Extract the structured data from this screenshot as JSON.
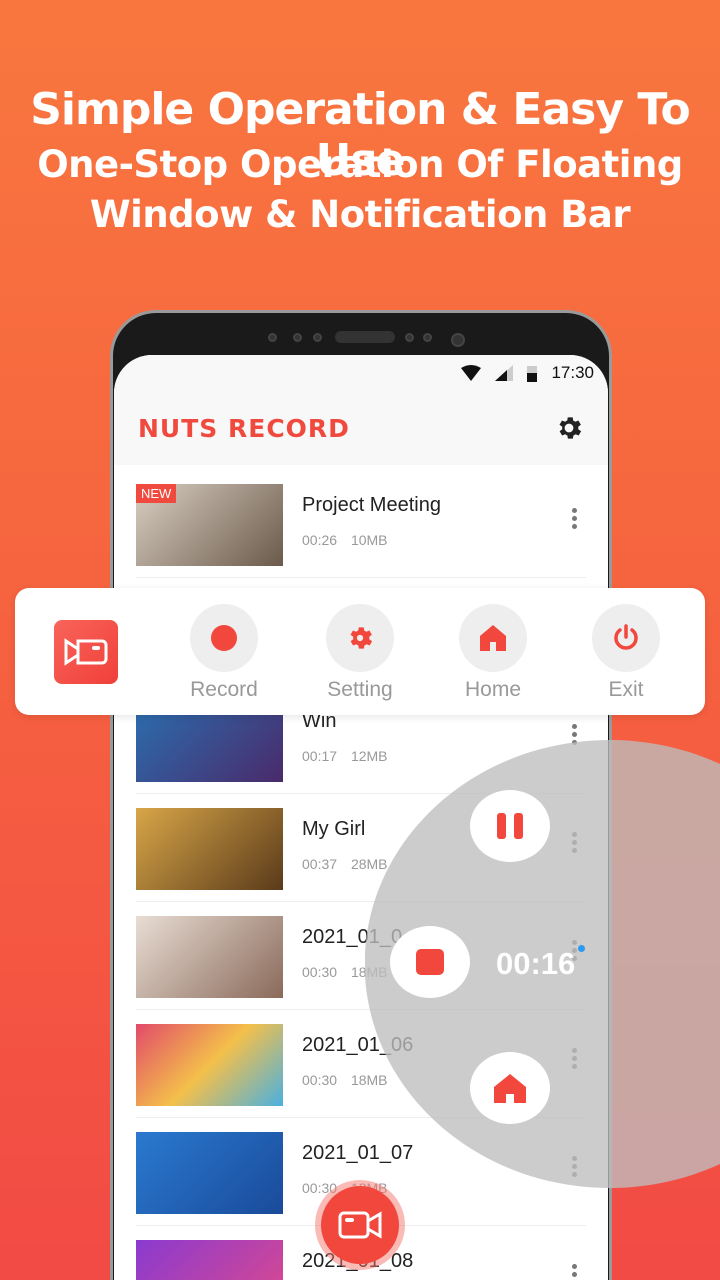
{
  "headline": "Simple Operation & Easy To Use",
  "subheadline_line1": "One-Stop Operation Of Floating",
  "subheadline_line2": "Window & Notification Bar",
  "status_bar": {
    "time": "17:30"
  },
  "app": {
    "logo_text": "NUTS RECORD",
    "accent": "#f04a3f"
  },
  "videos": [
    {
      "title": "Project Meeting",
      "duration": "00:26",
      "size": "10MB",
      "badge": "NEW"
    },
    {
      "title": "",
      "duration": "",
      "size": ""
    },
    {
      "title": "Win",
      "duration": "00:17",
      "size": "12MB"
    },
    {
      "title": "My Girl",
      "duration": "00:37",
      "size": "28MB"
    },
    {
      "title": "2021_01_0",
      "duration": "00:30",
      "size": "18MB"
    },
    {
      "title": "2021_01_06",
      "duration": "00:30",
      "size": "18MB"
    },
    {
      "title": "2021_01_07",
      "duration": "00:30",
      "size": "18MB"
    },
    {
      "title": "2021_01_08",
      "duration": "",
      "size": ""
    }
  ],
  "floating_bar": {
    "items": [
      {
        "label": "Record",
        "icon": "record-dot"
      },
      {
        "label": "Setting",
        "icon": "gear"
      },
      {
        "label": "Home",
        "icon": "home"
      },
      {
        "label": "Exit",
        "icon": "power"
      }
    ]
  },
  "floating_ball": {
    "timer": "00:16"
  }
}
